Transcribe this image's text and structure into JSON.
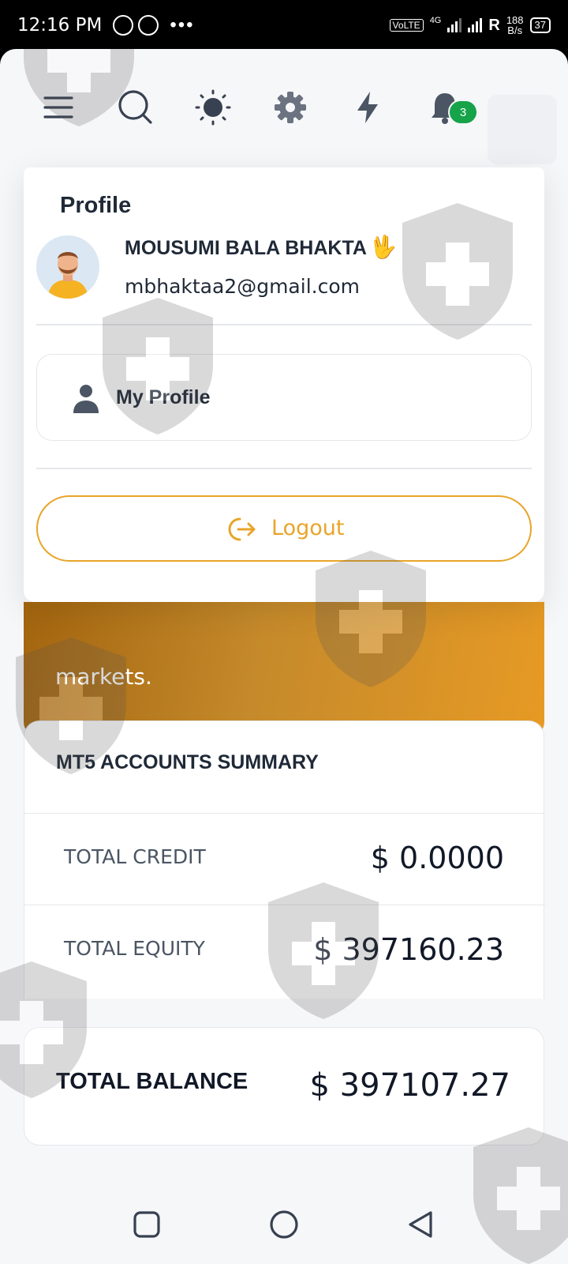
{
  "status_bar": {
    "time": "12:16 PM",
    "more_dots": "•••",
    "volte": "VoLTE",
    "network": "4G",
    "roaming": "R",
    "speed_value": "188",
    "speed_unit": "B/s",
    "battery": "37"
  },
  "topbar": {
    "notification_count": "3"
  },
  "profile_menu": {
    "title": "Profile",
    "name": "MOUSUMI BALA BHAKTA",
    "hand_emoji": "🖖",
    "email": "mbhaktaa2@gmail.com",
    "my_profile_label": "My Profile",
    "logout_label": "Logout"
  },
  "banner": {
    "text": "markets."
  },
  "summary": {
    "title": "MT5 ACCOUNTS SUMMARY",
    "rows": [
      {
        "label": "TOTAL CREDIT",
        "value": "$ 0.0000"
      },
      {
        "label": "TOTAL EQUITY",
        "value": "$ 397160.23"
      }
    ]
  },
  "balance": {
    "label": "TOTAL BALANCE",
    "value": "$ 397107.27"
  },
  "colors": {
    "accent": "#e8a52a",
    "badge": "#16a34a",
    "text": "#1f2937"
  }
}
